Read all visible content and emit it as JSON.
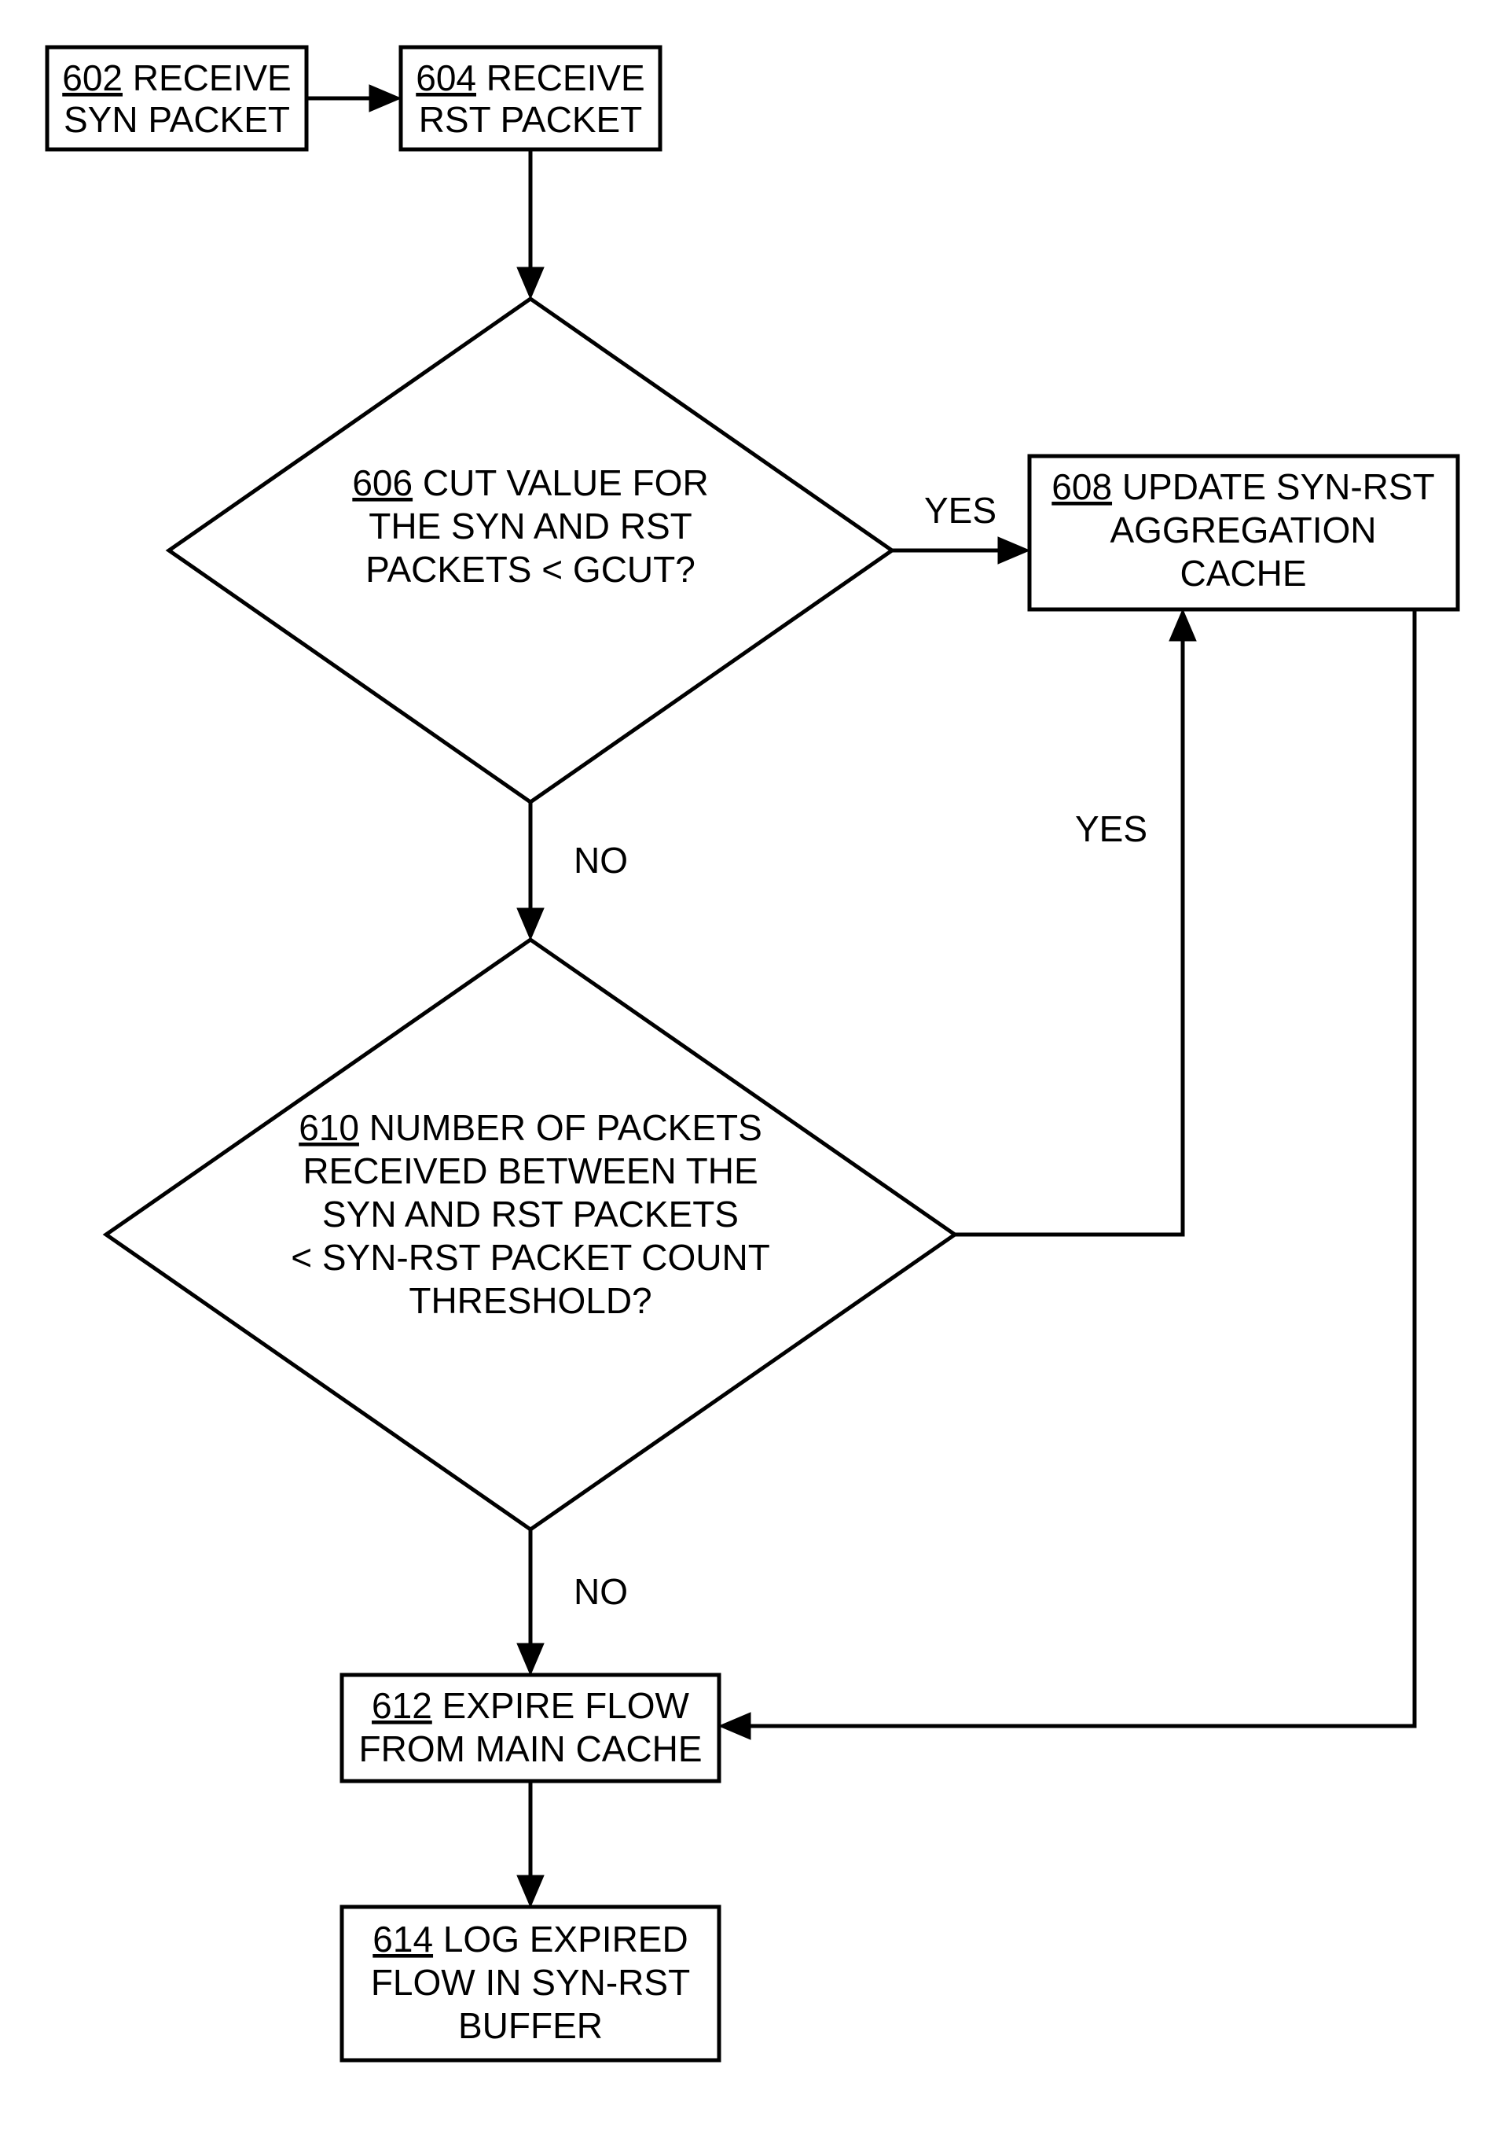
{
  "nodes": {
    "n602": {
      "num": "602",
      "l1": " RECEIVE",
      "l2": "SYN PACKET"
    },
    "n604": {
      "num": "604",
      "l1": " RECEIVE",
      "l2": "RST PACKET"
    },
    "n606": {
      "num": "606",
      "l1": " CUT VALUE FOR",
      "l2": "THE SYN AND RST",
      "l3": "PACKETS < GCUT?"
    },
    "n608": {
      "num": "608",
      "l1": " UPDATE SYN-RST",
      "l2": "AGGREGATION",
      "l3": "CACHE"
    },
    "n610": {
      "num": "610",
      "l1": " NUMBER OF PACKETS",
      "l2": "RECEIVED BETWEEN THE",
      "l3": "SYN AND RST PACKETS",
      "l4": "< SYN-RST PACKET COUNT",
      "l5": "THRESHOLD?"
    },
    "n612": {
      "num": "612",
      "l1": " EXPIRE FLOW",
      "l2": "FROM MAIN CACHE"
    },
    "n614": {
      "num": "614",
      "l1": " LOG EXPIRED",
      "l2": "FLOW IN SYN-RST",
      "l3": "BUFFER"
    }
  },
  "labels": {
    "yes": "YES",
    "no": "NO"
  }
}
